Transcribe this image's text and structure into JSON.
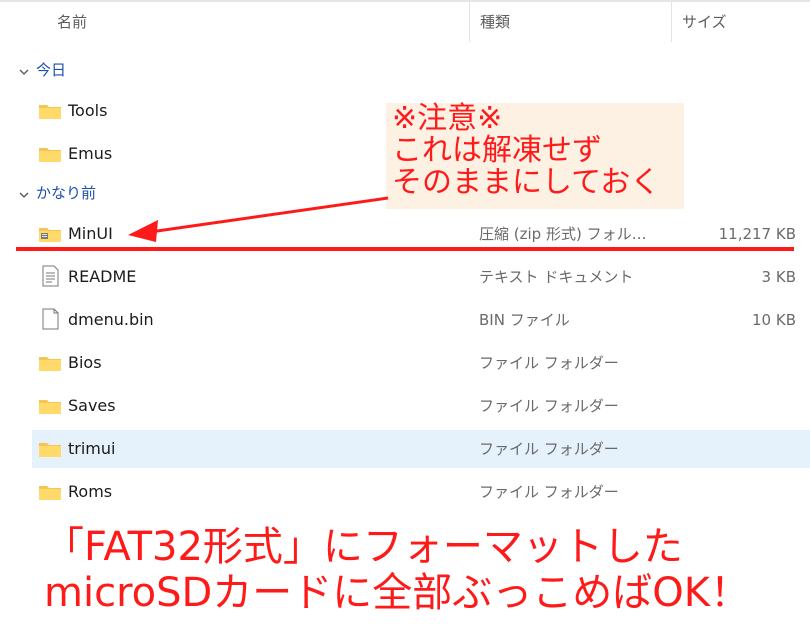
{
  "columns": {
    "name": "名前",
    "type": "種類",
    "size": "サイズ"
  },
  "groups": [
    {
      "label": "今日"
    },
    {
      "label": "かなり前"
    }
  ],
  "rows": [
    {
      "name": "Tools",
      "type": "",
      "size": "",
      "icon": "folder-icon"
    },
    {
      "name": "Emus",
      "type": "",
      "size": "",
      "icon": "folder-icon"
    },
    {
      "name": "MinUI",
      "type": "圧縮 (zip 形式) フォル…",
      "size": "11,217 KB",
      "icon": "zip-folder-icon"
    },
    {
      "name": "README",
      "type": "テキスト ドキュメント",
      "size": "3 KB",
      "icon": "text-document-icon"
    },
    {
      "name": "dmenu.bin",
      "type": "BIN ファイル",
      "size": "10 KB",
      "icon": "file-icon"
    },
    {
      "name": "Bios",
      "type": "ファイル フォルダー",
      "size": "",
      "icon": "folder-icon"
    },
    {
      "name": "Saves",
      "type": "ファイル フォルダー",
      "size": "",
      "icon": "folder-icon"
    },
    {
      "name": "trimui",
      "type": "ファイル フォルダー",
      "size": "",
      "icon": "folder-icon",
      "selected": true
    },
    {
      "name": "Roms",
      "type": "ファイル フォルダー",
      "size": "",
      "icon": "folder-icon"
    }
  ],
  "annotation": {
    "line1": "※注意※",
    "line2": "これは解凍せず",
    "line3": "そのままにしておく",
    "color": "#ff1a1a"
  },
  "bottom_note": {
    "line1": "「FAT32形式」にフォーマットした",
    "line2": "microSDカードに全部ぶっこめばOK！"
  }
}
